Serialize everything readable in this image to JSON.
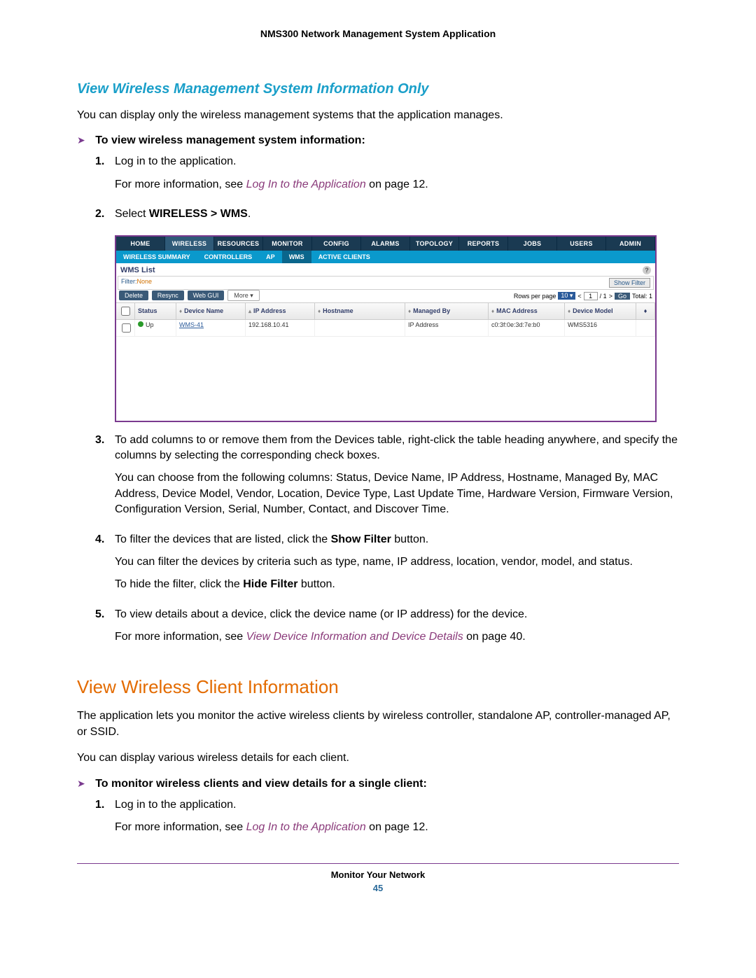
{
  "header": "NMS300 Network Management System Application",
  "section1": {
    "title": "View Wireless Management System Information Only",
    "intro": "You can display only the wireless management systems that the application manages.",
    "task": "To view wireless management system information:",
    "step1_num": "1.",
    "step1_a": "Log in to the application.",
    "step1_b_pre": "For more information, see ",
    "step1_b_link": "Log In to the Application",
    "step1_b_post": " on page 12.",
    "step2_num": "2.",
    "step2_pre": "Select ",
    "step2_bold": "WIRELESS > WMS",
    "step2_post": ".",
    "step3_num": "3.",
    "step3_a": "To add columns to or remove them from the Devices table, right-click the table heading anywhere, and specify the columns by selecting the corresponding check boxes.",
    "step3_b": "You can choose from the following columns: Status, Device Name, IP Address, Hostname, Managed By, MAC Address, Device Model, Vendor, Location, Device Type, Last Update Time, Hardware Version, Firmware Version, Configuration Version, Serial, Number, Contact, and Discover Time.",
    "step4_num": "4.",
    "step4_pre": "To filter the devices that are listed, click the ",
    "step4_bold": "Show Filter",
    "step4_post": " button.",
    "step4_b": "You can filter the devices by criteria such as type, name, IP address, location, vendor, model, and status.",
    "step4_c_pre": "To hide the filter, click the ",
    "step4_c_bold": "Hide Filter",
    "step4_c_post": " button.",
    "step5_num": "5.",
    "step5_a": "To view details about a device, click the device name (or IP address) for the device.",
    "step5_b_pre": "For more information, see ",
    "step5_b_link": "View Device Information and Device Details",
    "step5_b_post": " on page 40."
  },
  "section2": {
    "h2": "View Wireless Client Information",
    "p1": "The application lets you monitor the active wireless clients by wireless controller, standalone AP, controller-managed AP, or SSID.",
    "p2": "You can display various wireless details for each client.",
    "task": "To monitor wireless clients and view details for a single client:",
    "step1_num": "1.",
    "step1_a": "Log in to the application.",
    "step1_b_pre": "For more information, see ",
    "step1_b_link": "Log In to the Application",
    "step1_b_post": " on page 12."
  },
  "shot": {
    "nav": [
      "HOME",
      "WIRELESS",
      "RESOURCES",
      "MONITOR",
      "CONFIG",
      "ALARMS",
      "TOPOLOGY",
      "REPORTS",
      "JOBS",
      "USERS",
      "ADMIN"
    ],
    "subnav": {
      "summary": "WIRELESS SUMMARY",
      "controllers": "CONTROLLERS",
      "ap": "AP",
      "wms": "WMS",
      "active": "ACTIVE CLIENTS"
    },
    "list_title": "WMS List",
    "filter_label": "Filter:",
    "filter_value": "None",
    "show_filter": "Show Filter",
    "btns": {
      "delete": "Delete",
      "resync": "Resync",
      "webgui": "Web GUI",
      "more": "More ▾"
    },
    "pager": {
      "label": "Rows per page",
      "size": "10",
      "page": "1",
      "pages": "/ 1",
      "go": "Go",
      "total": "Total: 1"
    },
    "cols": {
      "status": "Status",
      "name": "Device Name",
      "ip": "IP Address",
      "host": "Hostname",
      "mgd": "Managed By",
      "mac": "MAC Address",
      "model": "Device Model"
    },
    "row": {
      "status": "Up",
      "name": "WMS-41",
      "ip": "192.168.10.41",
      "host": "",
      "mgd": "IP Address",
      "mac": "c0:3f:0e:3d:7e:b0",
      "model": "WMS5316"
    }
  },
  "footer": {
    "text": "Monitor Your Network",
    "page": "45"
  }
}
